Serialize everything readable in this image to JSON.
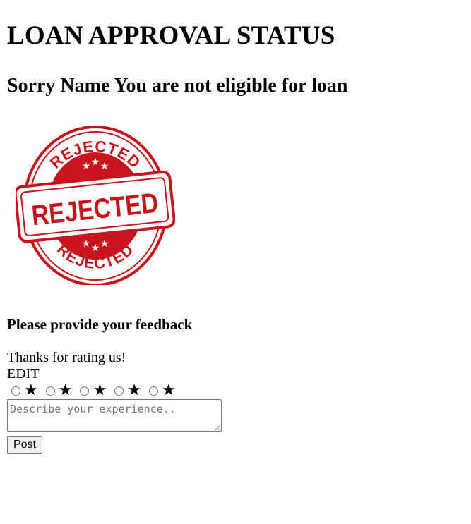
{
  "page": {
    "title": "LOAN APPROVAL STATUS",
    "message": "Sorry Name You are not eligible for loan"
  },
  "stamp": {
    "top_text": "REJECTED",
    "center_text": "REJECTED",
    "bottom_text": "REJECTED",
    "color": "#c8141c"
  },
  "feedback": {
    "heading": "Please provide your feedback",
    "thanks": "Thanks for rating us!",
    "edit_label": "EDIT",
    "stars": [
      {
        "icon": "star-icon",
        "glyph": "★"
      },
      {
        "icon": "star-icon",
        "glyph": "★"
      },
      {
        "icon": "star-icon",
        "glyph": "★"
      },
      {
        "icon": "star-icon",
        "glyph": "★"
      },
      {
        "icon": "star-icon",
        "glyph": "★"
      }
    ],
    "textarea_placeholder": "Describe your experience..",
    "textarea_value": "",
    "post_label": "Post"
  }
}
